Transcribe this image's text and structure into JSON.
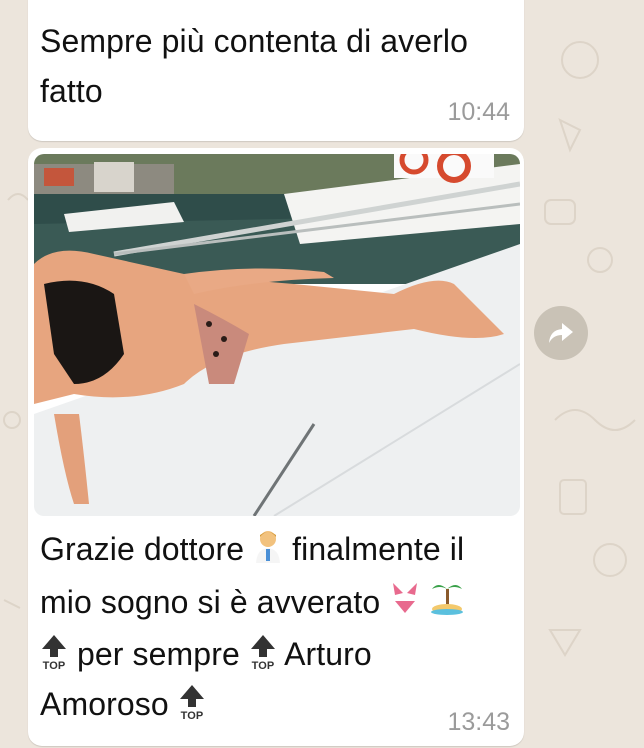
{
  "chat": {
    "messages": [
      {
        "text_line1": "Sempre più contenta di averlo",
        "text_line2": "fatto",
        "time": "10:44"
      },
      {
        "has_photo": true,
        "caption_seg1": "Grazie dottore",
        "caption_seg2": "finalmente il",
        "caption_seg3": "mio sogno si è avverato",
        "caption_seg4": "per sempre",
        "caption_seg5": "Arturo",
        "caption_seg6": "Amoroso",
        "time": "13:43",
        "emojis": [
          "doctor-emoji",
          "bikini-emoji",
          "palm-island-emoji",
          "top-arrow-emoji"
        ]
      }
    ]
  },
  "colors": {
    "wallpaper": "#ece5dc",
    "bubble": "#ffffff",
    "timestamp": "#9b9b9b",
    "forward_button": "#c9c2b6"
  }
}
